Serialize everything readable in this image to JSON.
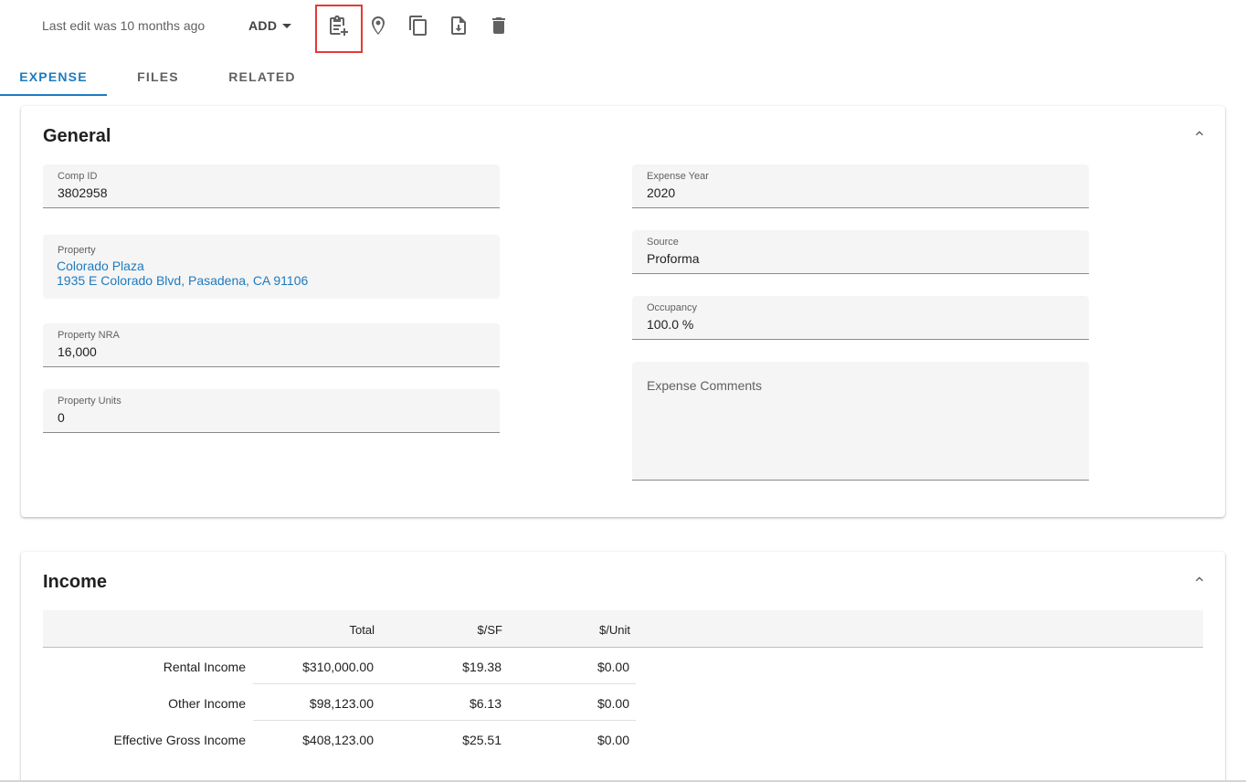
{
  "toolbar": {
    "last_edit": "Last edit was 10 months ago",
    "add_label": "ADD",
    "icons": [
      "clipboard-add-icon",
      "map-pin-icon",
      "copy-icon",
      "file-download-icon",
      "trash-icon"
    ]
  },
  "tabs": [
    {
      "label": "EXPENSE",
      "active": true
    },
    {
      "label": "FILES",
      "active": false
    },
    {
      "label": "RELATED",
      "active": false
    }
  ],
  "general": {
    "title": "General",
    "comp_id": {
      "label": "Comp ID",
      "value": "3802958"
    },
    "property": {
      "label": "Property",
      "name": "Colorado Plaza",
      "address": "1935 E Colorado Blvd, Pasadena, CA 91106"
    },
    "property_nra": {
      "label": "Property NRA",
      "value": "16,000"
    },
    "property_units": {
      "label": "Property Units",
      "value": "0"
    },
    "expense_year": {
      "label": "Expense Year",
      "value": "2020"
    },
    "source": {
      "label": "Source",
      "value": "Proforma"
    },
    "occupancy": {
      "label": "Occupancy",
      "value": "100.0 %"
    },
    "expense_comments": {
      "placeholder": "Expense Comments"
    }
  },
  "income": {
    "title": "Income",
    "columns": [
      "Total",
      "$/SF",
      "$/Unit"
    ],
    "rows": [
      {
        "label": "Rental Income",
        "total": "$310,000.00",
        "per_sf": "$19.38",
        "per_unit": "$0.00"
      },
      {
        "label": "Other Income",
        "total": "$98,123.00",
        "per_sf": "$6.13",
        "per_unit": "$0.00"
      },
      {
        "label": "Effective Gross Income",
        "total": "$408,123.00",
        "per_sf": "$25.51",
        "per_unit": "$0.00"
      }
    ]
  },
  "colors": {
    "accent": "#1e7bbf",
    "highlight": "#e53935"
  }
}
